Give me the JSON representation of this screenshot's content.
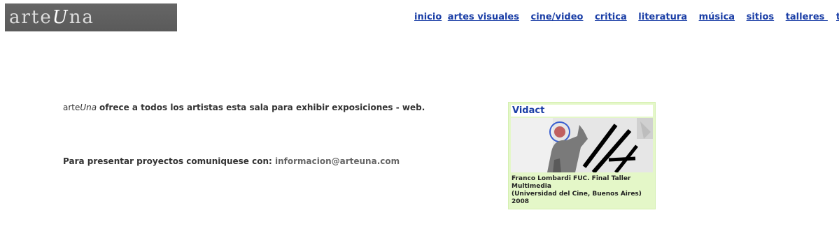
{
  "logo": {
    "prefix": "arte",
    "accent": "U",
    "suffix": "na"
  },
  "nav": [
    {
      "label": "inicio"
    },
    {
      "label": "artes visuales"
    },
    {
      "label": "cine/video"
    },
    {
      "label": "critica"
    },
    {
      "label": "literatura"
    },
    {
      "label": "música"
    },
    {
      "label": "sitios"
    },
    {
      "label": " talleres "
    },
    {
      "label": "teatro"
    }
  ],
  "intro": {
    "brand_prefix": "arte",
    "brand_accent": "Una",
    "text": "ofrece a todos los artistas esta sala para exhibir exposiciones - web."
  },
  "contact": {
    "label": "Para presentar proyectos comuniquese con:",
    "email": "informacion@arteuna.com"
  },
  "card": {
    "title": "Vidact",
    "caption_line1": "Franco Lombardi FUC. Final Taller Multimedia",
    "caption_line2": "(Universidad del Cine, Buenos Aires)",
    "caption_line3": "2008"
  },
  "colors": {
    "link": "#1a3ea6",
    "card_bg": "#e4f7c8",
    "logo_bg": "#5f5f5f"
  }
}
